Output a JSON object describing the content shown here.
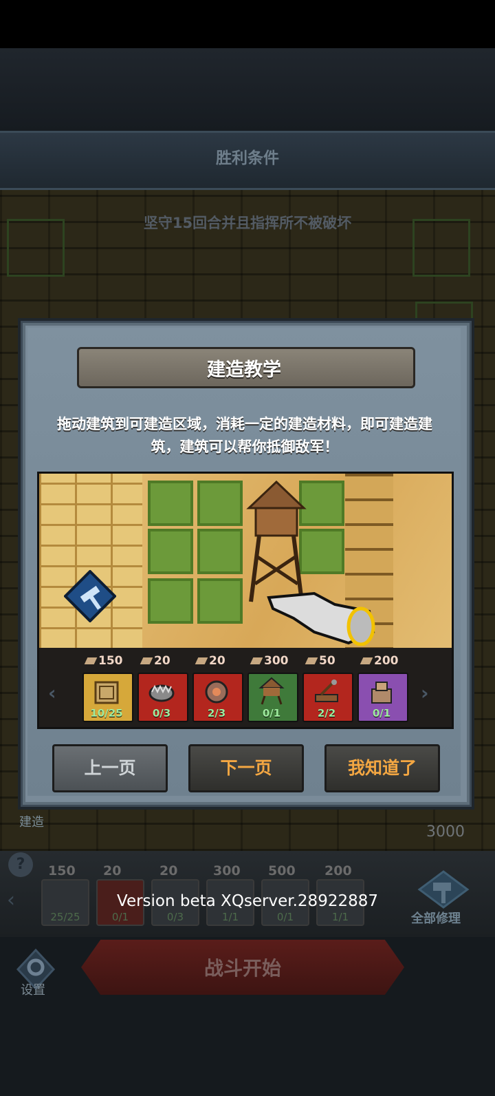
{
  "victory": {
    "title": "胜利条件",
    "condition": "坚守15回合并且指挥所不被破坏"
  },
  "background_hud": {
    "build_label": "建造",
    "money": "3000",
    "help_icon": "?",
    "bottom_costs": [
      "150",
      "20",
      "20",
      "300",
      "500",
      "200"
    ],
    "bottom_counts": [
      "25/25",
      "0/1",
      "0/3",
      "1/1",
      "0/1",
      "1/1"
    ],
    "repair_all_label": "全部修理",
    "battle_start_label": "战斗开始",
    "settings_label": "设置"
  },
  "version_text": "Version beta XQserver.28922887",
  "modal": {
    "title": "建造教学",
    "description": "拖动建筑到可建造区域，消耗一定的建造材料，即可建造建筑，建筑可以帮你抵御敌军！",
    "tray": {
      "costs": [
        "150",
        "20",
        "20",
        "300",
        "50",
        "200"
      ],
      "counts": [
        "10/25",
        "0/3",
        "2/3",
        "0/1",
        "2/2",
        "0/1"
      ],
      "card_colors": [
        "#d6a83a",
        "#b3261e",
        "#b3261e",
        "#3f7a3a",
        "#b3261e",
        "#8a4fb0"
      ],
      "card_icons": [
        "wall-icon",
        "bear-trap-icon",
        "spike-trap-icon",
        "watchtower-icon",
        "catapult-icon",
        "ballista-icon"
      ]
    },
    "buttons": {
      "prev": "上一页",
      "next": "下一页",
      "got_it": "我知道了"
    }
  }
}
